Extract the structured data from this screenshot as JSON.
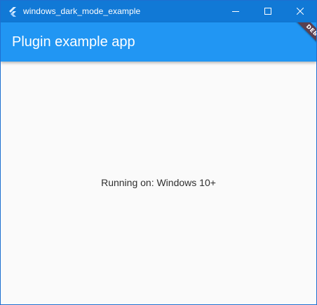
{
  "window": {
    "title": "windows_dark_mode_example",
    "titlebar_color": "#1179d6",
    "icon": "flutter-logo-icon",
    "controls": [
      "minimize-icon",
      "maximize-icon",
      "close-icon"
    ]
  },
  "appbar": {
    "title": "Plugin example app",
    "color": "#2196f3",
    "debug_banner": "DEBUG"
  },
  "body": {
    "text": "Running on: Windows 10+",
    "background": "#fafafa"
  }
}
